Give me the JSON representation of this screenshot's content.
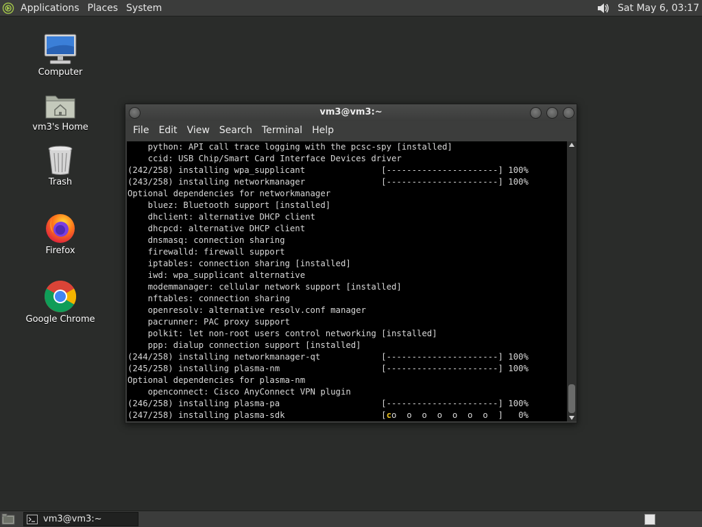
{
  "top_panel": {
    "menu": [
      "Applications",
      "Places",
      "System"
    ],
    "clock": "Sat May  6, 03:17",
    "volume_icon": "speaker-icon"
  },
  "desktop_icons": [
    {
      "label": "Computer",
      "icon": "computer-icon"
    },
    {
      "label": "vm3's Home",
      "icon": "home-folder-icon"
    },
    {
      "label": "Trash",
      "icon": "trash-icon"
    },
    {
      "label": "Firefox",
      "icon": "firefox-icon"
    },
    {
      "label": "Google Chrome",
      "icon": "chrome-icon"
    }
  ],
  "terminal": {
    "title": "vm3@vm3:~",
    "menu": [
      "File",
      "Edit",
      "View",
      "Search",
      "Terminal",
      "Help"
    ],
    "lines": [
      "    python: API call trace logging with the pcsc-spy [installed]",
      "    ccid: USB Chip/Smart Card Interface Devices driver",
      "(242/258) installing wpa_supplicant               [----------------------] 100%",
      "(243/258) installing networkmanager               [----------------------] 100%",
      "Optional dependencies for networkmanager",
      "    bluez: Bluetooth support [installed]",
      "    dhclient: alternative DHCP client",
      "    dhcpcd: alternative DHCP client",
      "    dnsmasq: connection sharing",
      "    firewalld: firewall support",
      "    iptables: connection sharing [installed]",
      "    iwd: wpa_supplicant alternative",
      "    modemmanager: cellular network support [installed]",
      "    nftables: connection sharing",
      "    openresolv: alternative resolv.conf manager",
      "    pacrunner: PAC proxy support",
      "    polkit: let non-root users control networking [installed]",
      "    ppp: dialup connection support [installed]",
      "(244/258) installing networkmanager-qt            [----------------------] 100%",
      "(245/258) installing plasma-nm                    [----------------------] 100%",
      "Optional dependencies for plasma-nm",
      "    openconnect: Cisco AnyConnect VPN plugin",
      "(246/258) installing plasma-pa                    [----------------------] 100%"
    ],
    "last_line_prefix": "(247/258) installing plasma-sdk                   [",
    "last_line_pacman": "c",
    "last_line_suffix": "o  o  o  o  o  o  o  ]   0%",
    "pacman_color": "#e8c020"
  },
  "taskbar": {
    "task_label": "vm3@vm3:~"
  }
}
